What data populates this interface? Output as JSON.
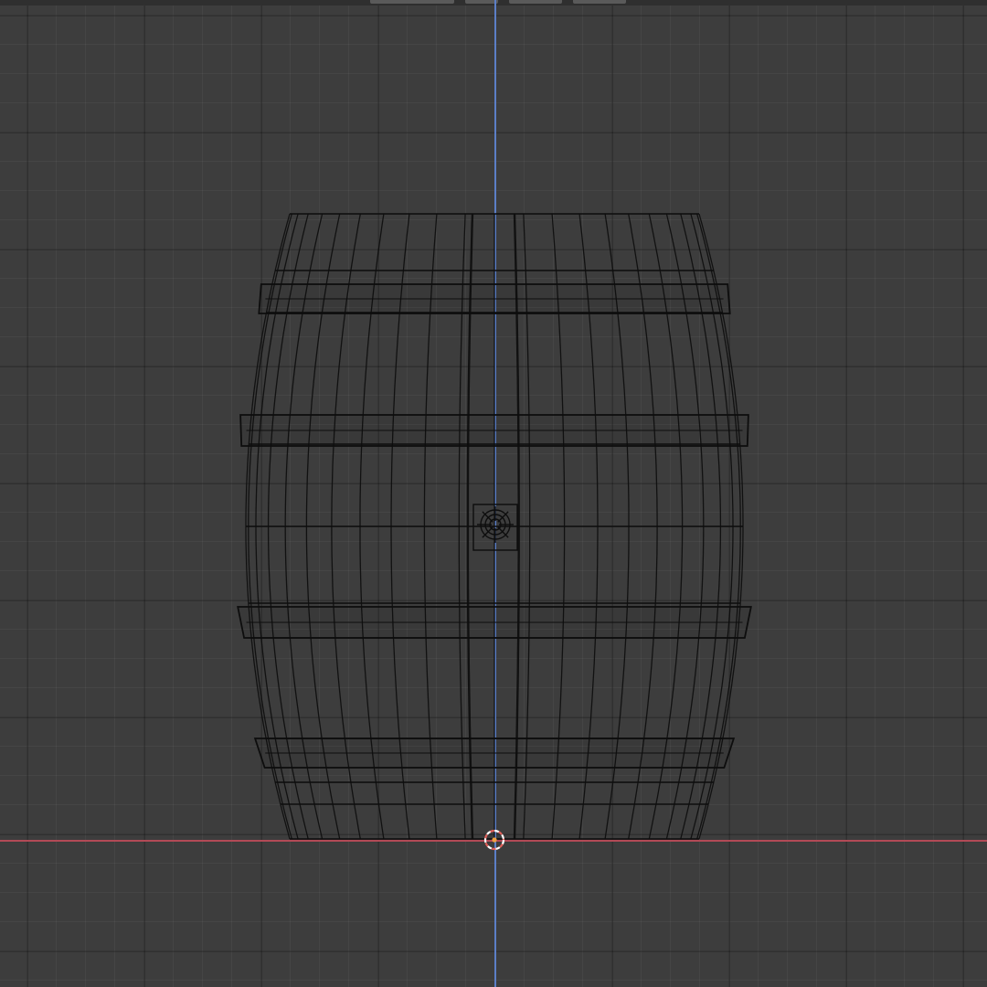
{
  "viewport": {
    "mode": "wireframe",
    "view": "front-orthographic",
    "object": "barrel",
    "icons": {
      "cursor": "3d-cursor-icon",
      "origin": "object-origin-icon"
    },
    "colors": {
      "background": "#3d3d3d",
      "wire": "#0d0d0d",
      "axis_z": "#5c7fc7",
      "axis_x": "#b24a56",
      "cursor_red": "#e0605a",
      "cursor_white": "#ffffff"
    }
  }
}
